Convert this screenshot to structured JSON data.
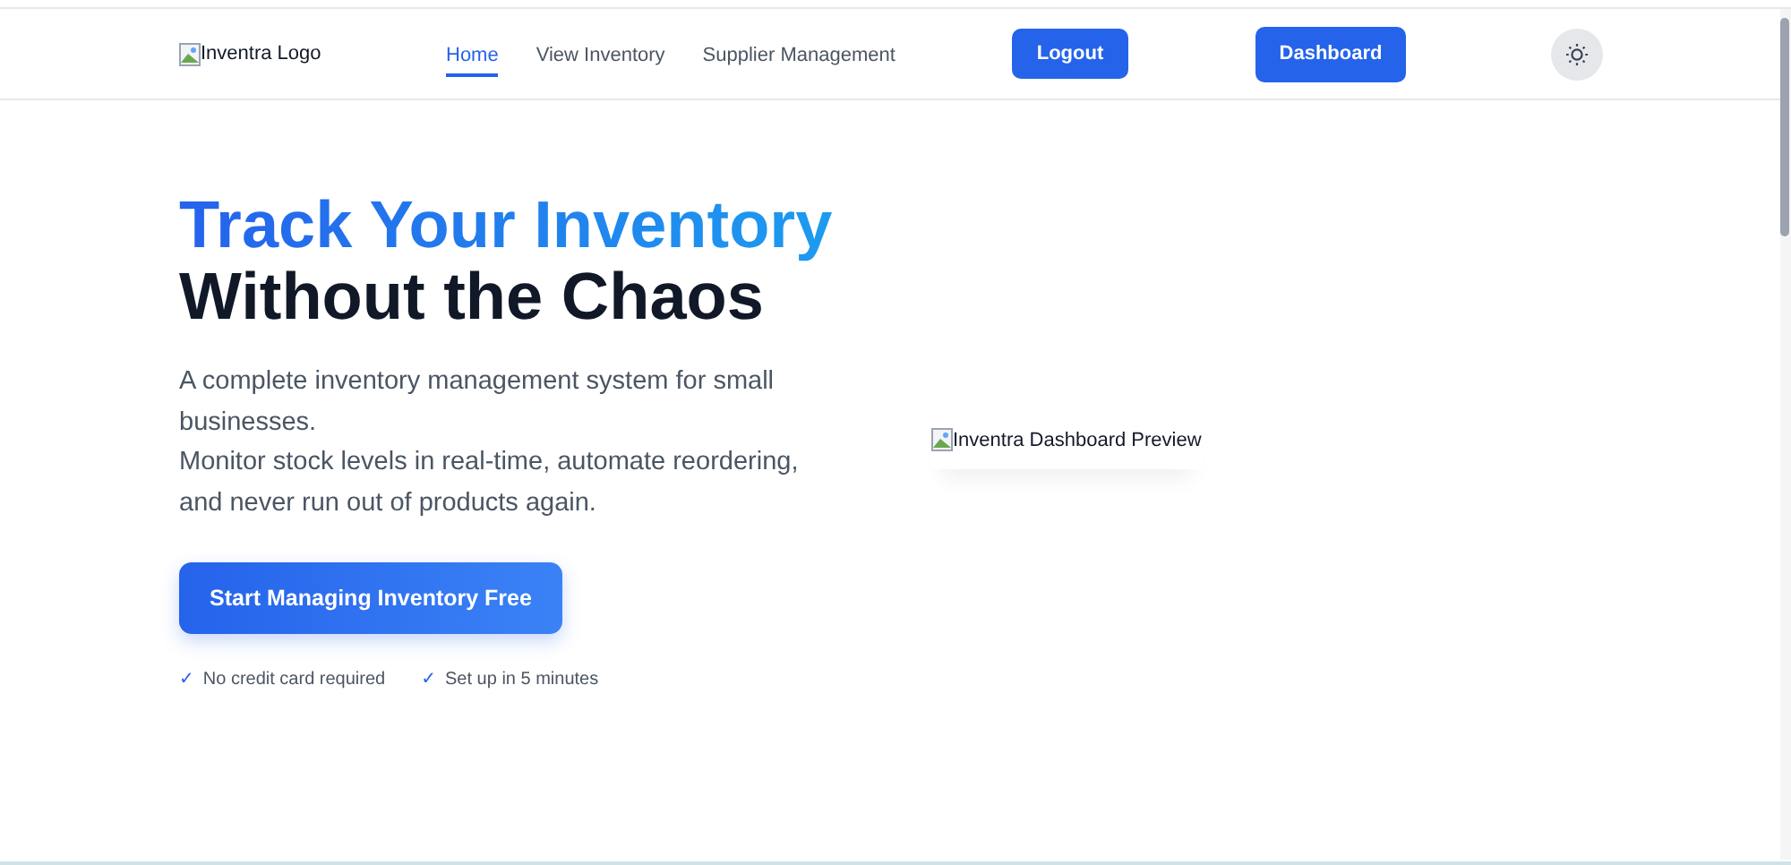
{
  "header": {
    "logo_alt": "Inventra Logo",
    "nav": [
      {
        "label": "Home",
        "selected": true
      },
      {
        "label": "View Inventory",
        "selected": false
      },
      {
        "label": "Supplier Management",
        "selected": false
      }
    ],
    "logout_button": "Logout",
    "dashboard_button": "Dashboard"
  },
  "hero": {
    "title_highlight": "Track Your Inventory",
    "title_rest": "Without the Chaos",
    "description": [
      "A complete inventory management system for small businesses.",
      "Monitor stock levels in real-time, automate reordering, and never run out of products again."
    ],
    "cta_button": "Start Managing Inventory Free",
    "benefits": [
      {
        "check": "✓",
        "text": "No credit card required"
      },
      {
        "check": "✓",
        "text": "Set up in 5 minutes"
      }
    ],
    "preview_alt": "Inventra Dashboard Preview"
  }
}
